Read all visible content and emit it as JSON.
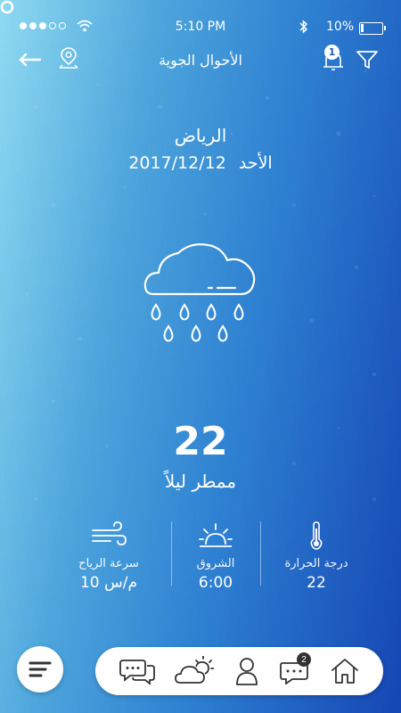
{
  "status_bar": {
    "time": "5:10 PM",
    "battery": "10%"
  },
  "header": {
    "title": "الأحوال الجوية",
    "notification_count": "1"
  },
  "location": {
    "city": "الرياض",
    "day": "الأحد",
    "date": "2017/12/12"
  },
  "current": {
    "temperature": "22",
    "condition": "ممطر ليلاً"
  },
  "stats": [
    {
      "label": "درجة الحرارة",
      "value": "22",
      "icon": "thermometer-icon"
    },
    {
      "label": "الشروق",
      "value": "6:00",
      "icon": "sunrise-icon"
    },
    {
      "label": "سرعة الرياح",
      "value": "10 م/س",
      "icon": "wind-icon"
    }
  ],
  "nav": {
    "messages_badge": "2"
  },
  "colors": {
    "bg_start": "#8fdaf2",
    "bg_end": "#1546b4",
    "nav_bg": "#ffffff",
    "icon_dark": "#333333"
  }
}
